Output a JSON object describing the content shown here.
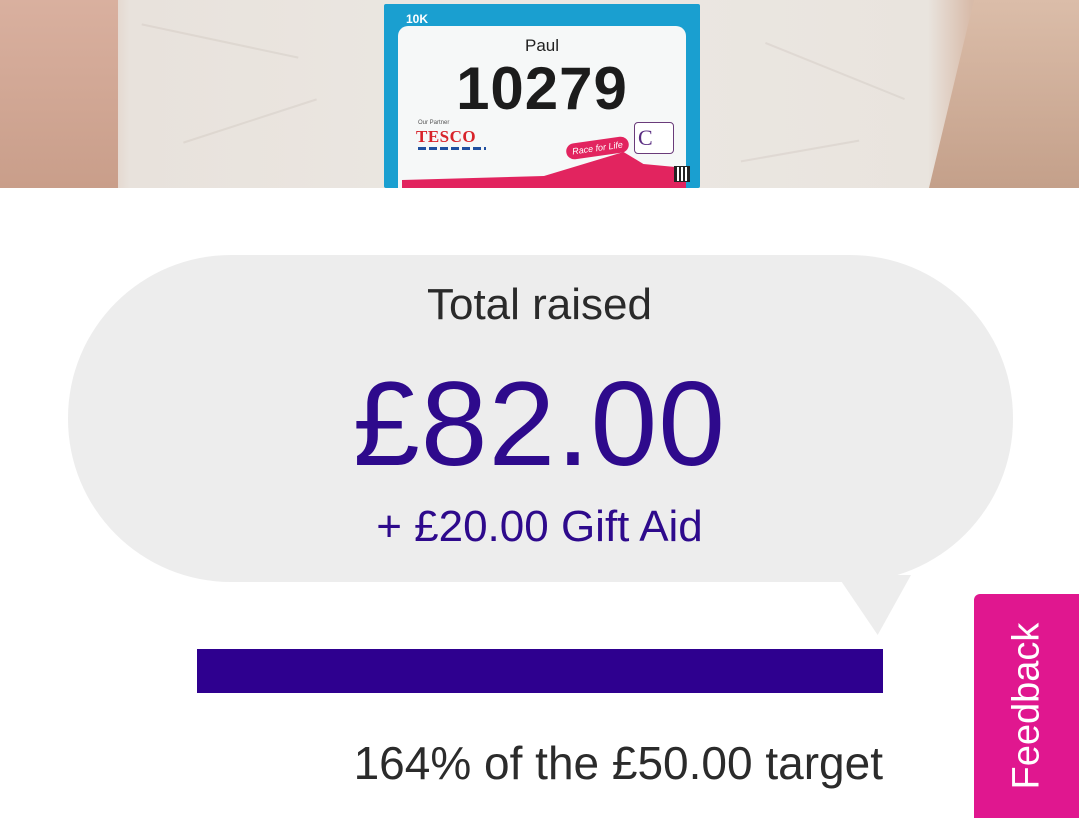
{
  "hero": {
    "bib": {
      "distance": "10K",
      "name": "Paul",
      "number": "10279",
      "partner_label": "Our Partner",
      "partner": "TESCO",
      "event": "Race for Life"
    }
  },
  "fundraising": {
    "total_label": "Total raised",
    "total_amount": "£82.00",
    "gift_aid": "+ £20.00 Gift Aid",
    "progress_fraction": 1.0,
    "target_text": "164% of the £50.00 target"
  },
  "feedback": {
    "label": "Feedback"
  },
  "colors": {
    "accent": "#2e008f",
    "feedback": "#e0178f",
    "bubble": "#ededed"
  }
}
